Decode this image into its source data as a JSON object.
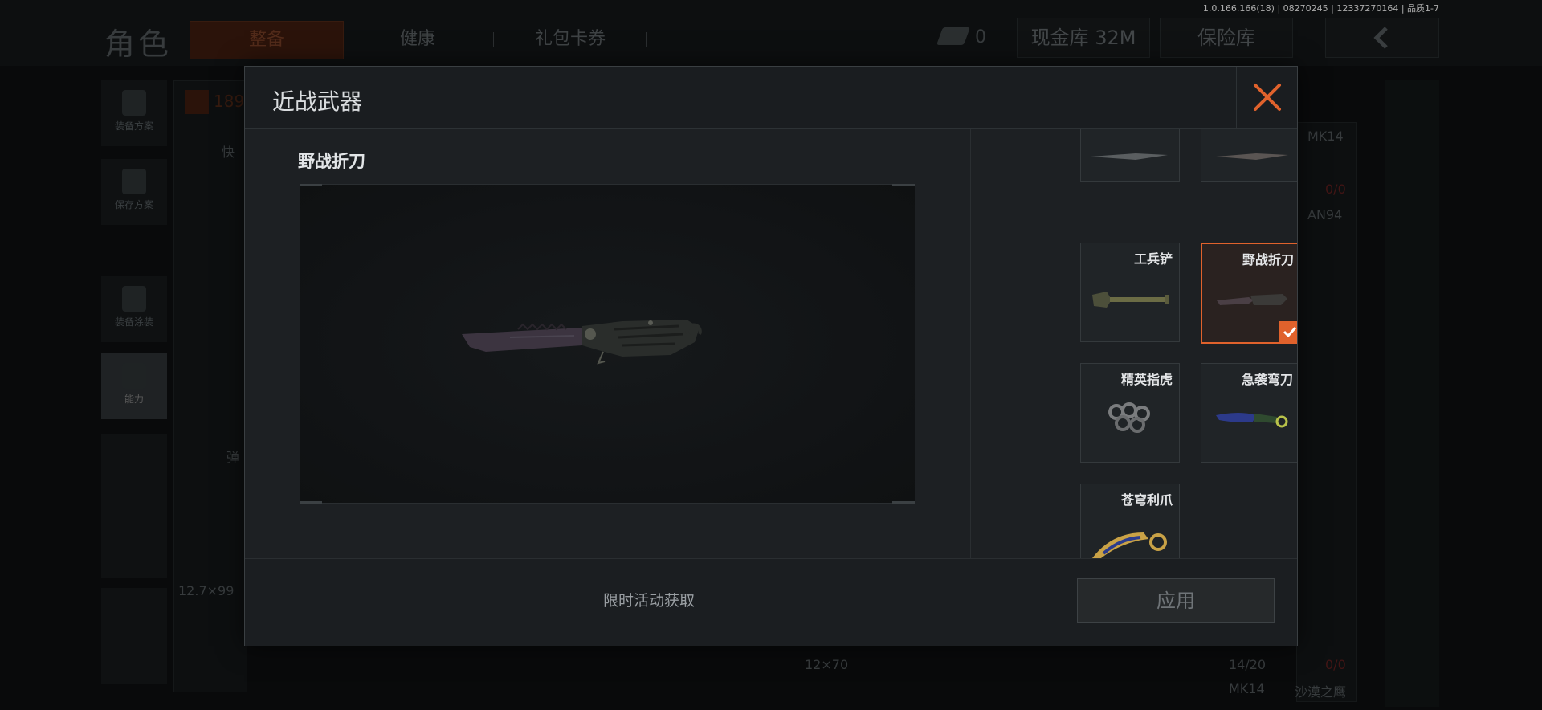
{
  "background": {
    "page_title": "角色",
    "tabs": [
      "整备",
      "健康",
      "礼包卡券"
    ],
    "cash_count": "0",
    "cash_vault_label": "现金库 32M",
    "safe_vault_label": "保险库",
    "version_info": "1.0.166.166(18) | 08270245 | 12337270164 | 品质1-7",
    "side_buttons": [
      "装备方案",
      "保存方案",
      "装备涂装",
      "能力"
    ],
    "panel_texts": {
      "armor_value": "189",
      "quick_label": "快",
      "ammo_label": "弹",
      "ammo_caliber": "12.7×99",
      "weapon_1": "MK14",
      "weapon_1_ammo": "0/0",
      "weapon_2": "AN94",
      "bottom_caliber": "12×70",
      "bottom_ammo_count": "14/20",
      "bottom_red": "0/0",
      "bottom_weapon": "MK14",
      "bottom_location": "沙漠之鹰"
    }
  },
  "modal": {
    "title": "近战武器",
    "selected_item_name": "野战折刀",
    "obtain_text": "限时活动获取",
    "apply_label": "应用",
    "items": [
      {
        "label": "",
        "selected": false,
        "icon": "knife-icon"
      },
      {
        "label": "",
        "selected": false,
        "icon": "knife-icon"
      },
      {
        "label": "工兵铲",
        "selected": false,
        "icon": "shovel-icon"
      },
      {
        "label": "野战折刀",
        "selected": true,
        "icon": "folding-knife-icon"
      },
      {
        "label": "精英指虎",
        "selected": false,
        "icon": "knuckles-icon"
      },
      {
        "label": "急袭弯刀",
        "selected": false,
        "icon": "curved-knife-icon"
      },
      {
        "label": "苍穹利爪",
        "selected": false,
        "icon": "karambit-icon"
      }
    ]
  },
  "colors": {
    "accent": "#e0622c",
    "modal_bg": "#1d2023"
  }
}
